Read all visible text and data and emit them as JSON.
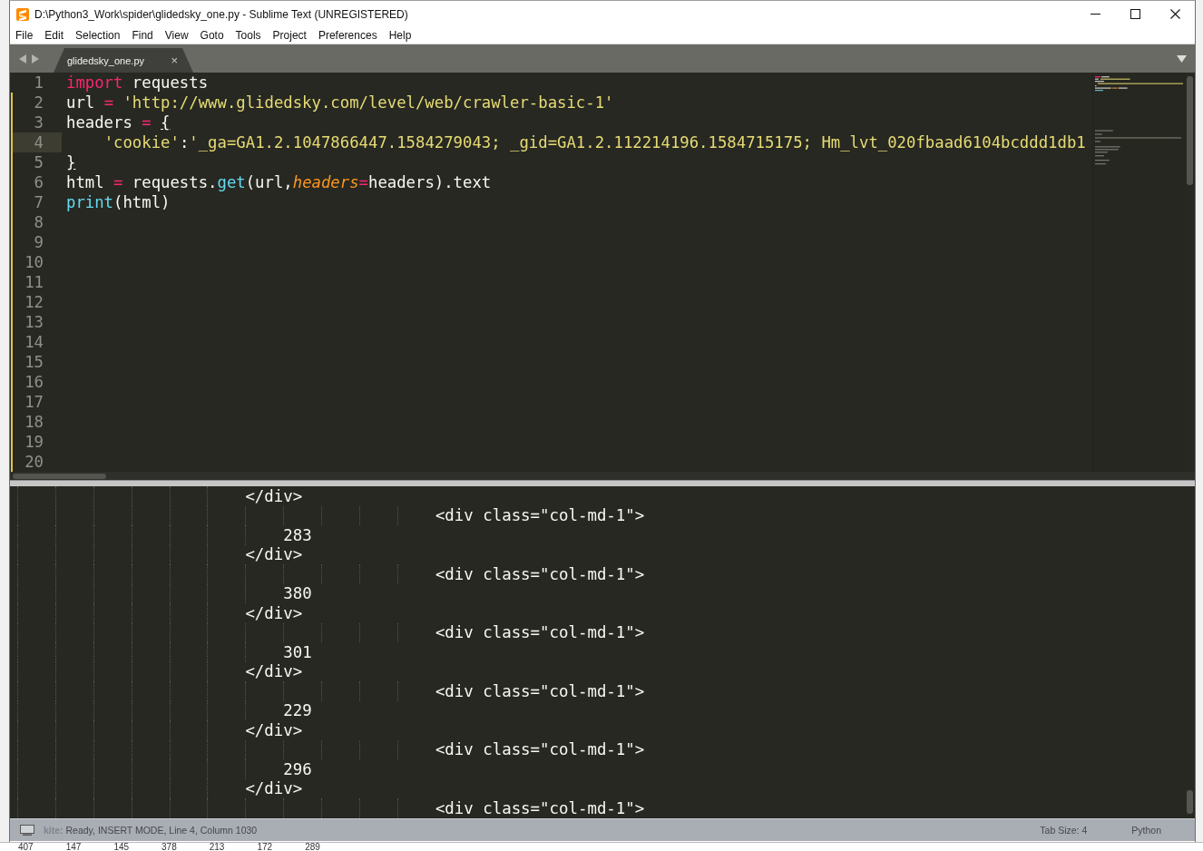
{
  "window": {
    "title": "D:\\Python3_Work\\spider\\glidedsky_one.py - Sublime Text (UNREGISTERED)"
  },
  "menu": [
    "File",
    "Edit",
    "Selection",
    "Find",
    "View",
    "Goto",
    "Tools",
    "Project",
    "Preferences",
    "Help"
  ],
  "tabs": [
    {
      "label": "glidedsky_one.py",
      "close": "×",
      "selected": true
    }
  ],
  "editor": {
    "lines": [
      {
        "number": "1",
        "modified": false,
        "current": false,
        "tokens": [
          {
            "kind": "keyword",
            "text": "import"
          },
          {
            "kind": "plain",
            "text": " requests"
          }
        ]
      },
      {
        "number": "2",
        "modified": true,
        "current": false,
        "tokens": [
          {
            "kind": "plain",
            "text": "url "
          },
          {
            "kind": "operator",
            "text": "= "
          },
          {
            "kind": "string",
            "text": "'http://www.glidedsky.com/level/web/crawler-basic-1'"
          }
        ]
      },
      {
        "number": "3",
        "modified": true,
        "current": false,
        "tokens": [
          {
            "kind": "plain",
            "text": "headers "
          },
          {
            "kind": "operator",
            "text": "= "
          },
          {
            "kind": "bracket_match",
            "text": "{"
          }
        ]
      },
      {
        "number": "4",
        "modified": true,
        "current": true,
        "tokens": [
          {
            "kind": "string",
            "text": "    'cookie'"
          },
          {
            "kind": "plain",
            "text": ":"
          },
          {
            "kind": "string",
            "text": "'_ga=GA1.2.1047866447.1584279043; _gid=GA1.2.112214196.1584715175; Hm_lvt_020fbaad6104bcddd1db1"
          }
        ]
      },
      {
        "number": "5",
        "modified": true,
        "current": false,
        "tokens": [
          {
            "kind": "bracket_match",
            "text": "}"
          }
        ]
      },
      {
        "number": "6",
        "modified": true,
        "current": false,
        "tokens": [
          {
            "kind": "plain",
            "text": "html "
          },
          {
            "kind": "operator",
            "text": "="
          },
          {
            "kind": "plain",
            "text": " requests."
          },
          {
            "kind": "function",
            "text": "get"
          },
          {
            "kind": "plain",
            "text": "(url,"
          },
          {
            "kind": "param",
            "text": "headers"
          },
          {
            "kind": "operator",
            "text": "="
          },
          {
            "kind": "plain",
            "text": "headers).text"
          }
        ]
      },
      {
        "number": "7",
        "modified": true,
        "current": false,
        "tokens": [
          {
            "kind": "function",
            "text": "print"
          },
          {
            "kind": "plain",
            "text": "(html)"
          }
        ]
      },
      {
        "number": "8",
        "modified": true,
        "current": false
      },
      {
        "number": "9",
        "modified": true,
        "current": false
      },
      {
        "number": "10",
        "modified": true,
        "current": false
      },
      {
        "number": "11",
        "modified": true,
        "current": false
      },
      {
        "number": "12",
        "modified": true,
        "current": false
      },
      {
        "number": "13",
        "modified": true,
        "current": false
      },
      {
        "number": "14",
        "modified": true,
        "current": false
      },
      {
        "number": "15",
        "modified": true,
        "current": false
      },
      {
        "number": "16",
        "modified": true,
        "current": false
      },
      {
        "number": "17",
        "modified": true,
        "current": false
      },
      {
        "number": "18",
        "modified": true,
        "current": false
      },
      {
        "number": "19",
        "modified": true,
        "current": false
      },
      {
        "number": "20",
        "modified": true,
        "current": false
      }
    ]
  },
  "output": {
    "lines": [
      "                        </div>",
      "                                            <div class=\"col-md-1\">",
      "                            283",
      "                        </div>",
      "                                            <div class=\"col-md-1\">",
      "                            380",
      "                        </div>",
      "                                            <div class=\"col-md-1\">",
      "                            301",
      "                        </div>",
      "                                            <div class=\"col-md-1\">",
      "                            229",
      "                        </div>",
      "                                            <div class=\"col-md-1\">",
      "                            296",
      "                        </div>",
      "                                            <div class=\"col-md-1\">"
    ]
  },
  "status_bar": {
    "message": "**kite:** Ready, INSERT MODE, Line 4, Column 1030",
    "tab_size": "Tab Size: 4",
    "syntax": "Python"
  },
  "background_window": {
    "numbers": [
      "407",
      "147",
      "145",
      "378",
      "213",
      "172",
      "289"
    ]
  }
}
